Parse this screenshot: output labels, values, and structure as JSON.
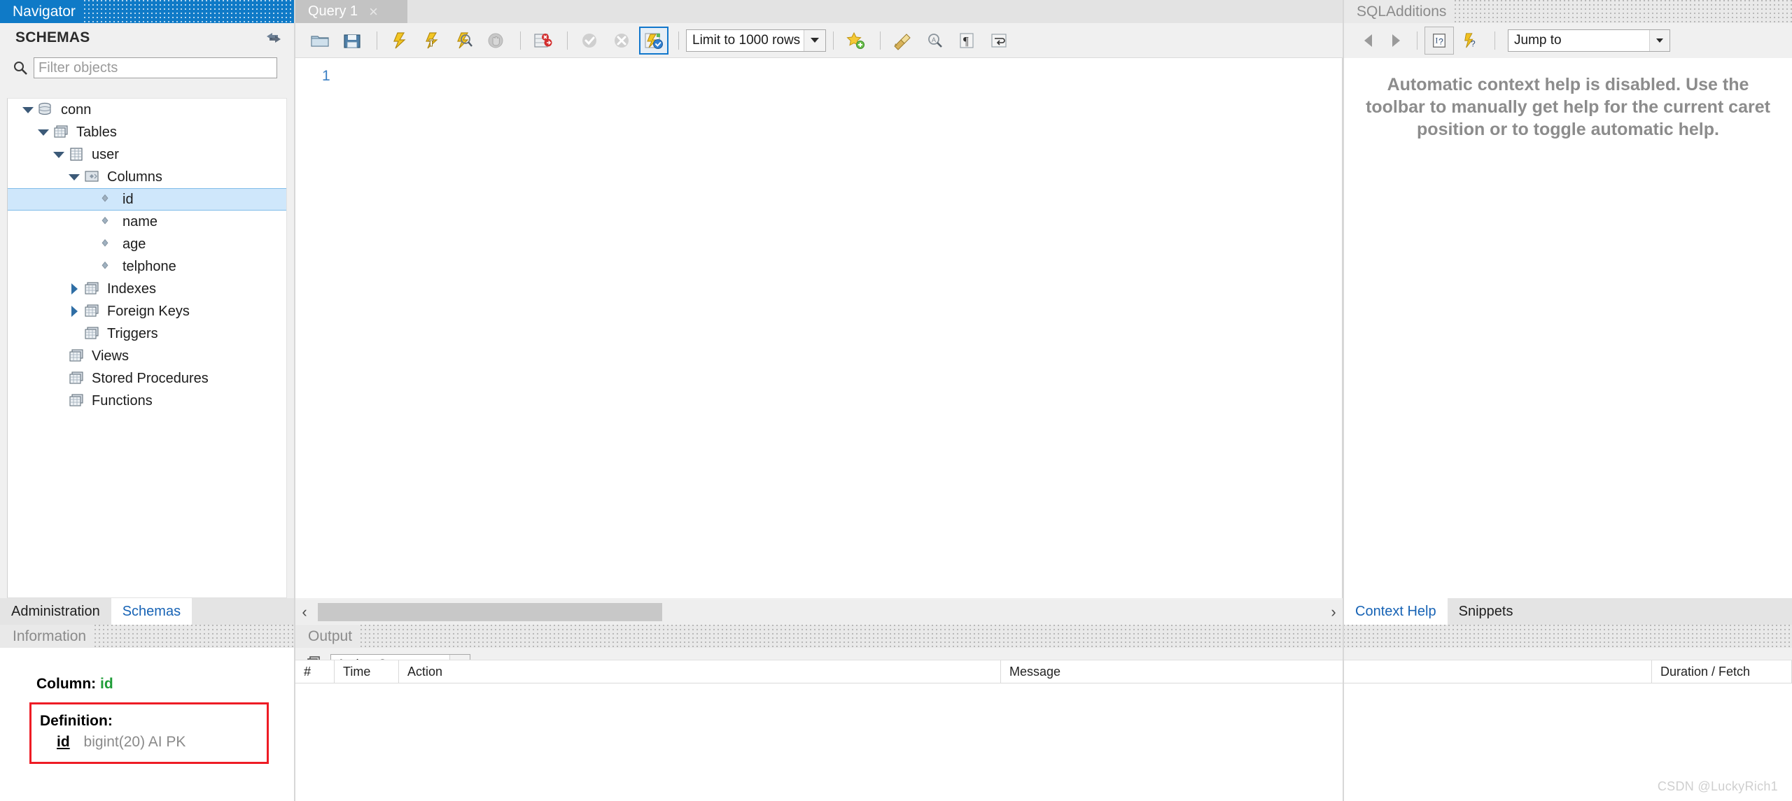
{
  "navigator": {
    "caption": "Navigator",
    "schemas_label": "SCHEMAS",
    "refresh_icon": "refresh-schemas-icon",
    "filter": {
      "placeholder": "Filter objects",
      "value": "",
      "icon": "search-icon"
    },
    "tree": [
      {
        "label": "conn",
        "indent": 0,
        "twisty": "down",
        "icon": "database-icon"
      },
      {
        "label": "Tables",
        "indent": 1,
        "twisty": "down",
        "icon": "tables-folder-icon"
      },
      {
        "label": "user",
        "indent": 2,
        "twisty": "down",
        "icon": "table-icon"
      },
      {
        "label": "Columns",
        "indent": 3,
        "twisty": "down",
        "icon": "columns-folder-icon"
      },
      {
        "label": "id",
        "indent": 4,
        "twisty": "none",
        "icon": "column-diamond-icon",
        "selected": true
      },
      {
        "label": "name",
        "indent": 4,
        "twisty": "none",
        "icon": "column-diamond-icon"
      },
      {
        "label": "age",
        "indent": 4,
        "twisty": "none",
        "icon": "column-diamond-icon"
      },
      {
        "label": "telphone",
        "indent": 4,
        "twisty": "none",
        "icon": "column-diamond-icon"
      },
      {
        "label": "Indexes",
        "indent": 3,
        "twisty": "right",
        "icon": "indexes-folder-icon"
      },
      {
        "label": "Foreign Keys",
        "indent": 3,
        "twisty": "right",
        "icon": "foreign-keys-folder-icon"
      },
      {
        "label": "Triggers",
        "indent": 3,
        "twisty": "none",
        "icon": "triggers-folder-icon"
      },
      {
        "label": "Views",
        "indent": 2,
        "twisty": "none",
        "icon": "views-folder-icon"
      },
      {
        "label": "Stored Procedures",
        "indent": 2,
        "twisty": "none",
        "icon": "stored-procedures-folder-icon"
      },
      {
        "label": "Functions",
        "indent": 2,
        "twisty": "none",
        "icon": "functions-folder-icon"
      }
    ],
    "tabs": [
      {
        "label": "Administration",
        "active": false
      },
      {
        "label": "Schemas",
        "active": true
      }
    ]
  },
  "information": {
    "caption": "Information",
    "column_prefix": "Column:",
    "column_name": "id",
    "definition_label": "Definition:",
    "definition_field": "id",
    "definition_type": "bigint(20) AI PK",
    "highlight_color": "#ee1c25"
  },
  "query": {
    "tab": {
      "label": "Query 1",
      "close": "×"
    },
    "toolbar": [
      {
        "name": "open-sql-script-icon",
        "title": "Open a SQL script file"
      },
      {
        "name": "save-sql-script-icon",
        "title": "Save SQL script to file"
      },
      {
        "name": "execute-statement-icon",
        "title": "Execute statement"
      },
      {
        "name": "execute-current-statement-icon",
        "title": "Execute current statement"
      },
      {
        "name": "explain-query-icon",
        "title": "Explain query"
      },
      {
        "name": "stop-execution-icon",
        "title": "Stop statement execution"
      },
      {
        "name": "toggle-stop-on-error-icon",
        "title": "Toggle stop on error"
      },
      {
        "name": "commit-icon",
        "title": "Commit transaction"
      },
      {
        "name": "rollback-icon",
        "title": "Rollback transaction"
      },
      {
        "name": "toggle-autocommit-icon",
        "title": "Toggle auto-commit",
        "boxed": true
      },
      {
        "name": "add-snippet-icon",
        "title": "Save snippet"
      },
      {
        "name": "beautify-sql-icon",
        "title": "Beautify SQL"
      },
      {
        "name": "find-icon",
        "title": "Find"
      },
      {
        "name": "show-invisible-chars-icon",
        "title": "Toggle invisible characters"
      },
      {
        "name": "wrap-lines-icon",
        "title": "Toggle wrapping of long lines"
      }
    ],
    "limit": {
      "value": "Limit to 1000 rows"
    },
    "editor": {
      "line_numbers": [
        "1"
      ],
      "content": ""
    },
    "hscroll": {
      "left_arrow": "‹",
      "right_arrow": "›"
    }
  },
  "output": {
    "caption": "Output",
    "selector_icon": "output-pages-icon",
    "selector_value": "Action Output",
    "columns": [
      "#",
      "Time",
      "Action",
      "Message",
      "Duration / Fetch"
    ],
    "rows": [],
    "watermark": "CSDN @LuckyRich1"
  },
  "sql_additions": {
    "caption": "SQLAdditions",
    "nav_back_icon": "nav-back-icon",
    "nav_forward_icon": "nav-forward-icon",
    "manual_help_icon": "context-help-icon",
    "auto_help_icon": "automatic-context-help-icon",
    "jump_to": {
      "value": "Jump to"
    },
    "help_text": "Automatic context help is disabled. Use the toolbar to manually get help for the current caret position or to toggle automatic help.",
    "tabs": [
      {
        "label": "Context Help",
        "active": true
      },
      {
        "label": "Snippets",
        "active": false
      }
    ]
  },
  "colors": {
    "caption_blue": "#0f7ac7",
    "selection_blue": "#cfe7fb",
    "link_blue": "#1763b5",
    "column_green": "#1f9d38",
    "highlight_red": "#ee1c25"
  }
}
